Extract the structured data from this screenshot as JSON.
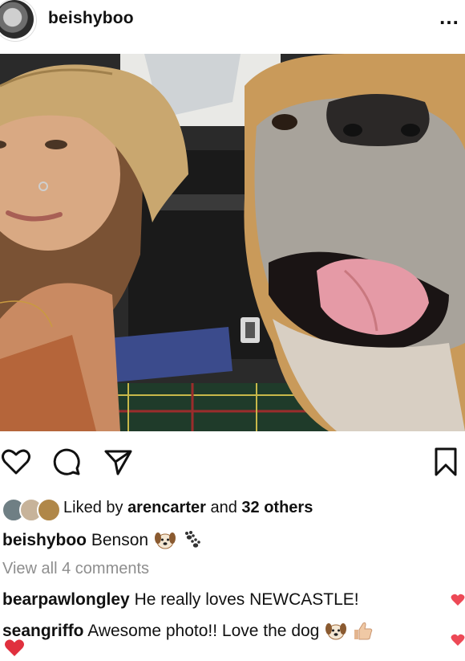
{
  "post": {
    "username": "beishyboo",
    "more_label": "…"
  },
  "likes": {
    "prefix": "Liked by",
    "first_liker": "arencarter",
    "joiner": "and",
    "others": "32 others"
  },
  "caption": {
    "username": "beishyboo",
    "text": "Benson"
  },
  "view_all_comments": "View all 4 comments",
  "comments": [
    {
      "username": "bearpawlongley",
      "text": "He really loves NEWCASTLE!"
    },
    {
      "username": "seangriffo",
      "text": "Awesome photo!! Love the dog"
    }
  ],
  "icons": {
    "like": "heart-outline-icon",
    "comment": "comment-bubble-icon",
    "share": "paper-plane-icon",
    "save": "bookmark-icon",
    "comment_like": "heart-filled-icon"
  },
  "colors": {
    "heart": "#ed4956",
    "muted_text": "#8e8e8e"
  }
}
